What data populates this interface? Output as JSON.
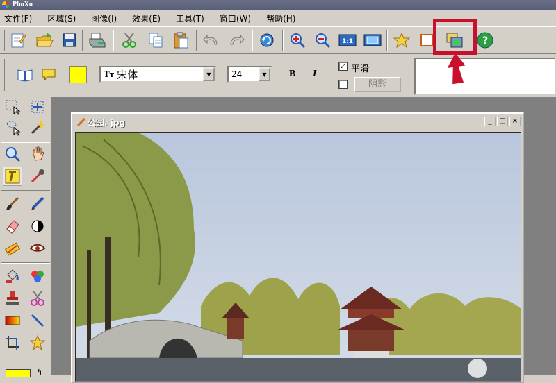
{
  "app": {
    "title": "PhoXo"
  },
  "menu": [
    "文件(F)",
    "区域(S)",
    "图像(I)",
    "效果(E)",
    "工具(T)",
    "窗口(W)",
    "帮助(H)"
  ],
  "toolbar": {
    "buttons": [
      "new",
      "open",
      "save",
      "print",
      "cut",
      "copy",
      "paste",
      "undo",
      "redo",
      "refresh",
      "zoom-in",
      "zoom-out",
      "actual-size",
      "fit-window",
      "favorite",
      "frame",
      "layer-image",
      "help"
    ],
    "help_glyph": "?",
    "actual_size_label": "1:1"
  },
  "text_toolbar": {
    "color": "#ffff00",
    "font_icon": "Tт",
    "font_value": "宋体",
    "size_value": "24",
    "bold_label": "B",
    "italic_label": "I",
    "smooth_label": "平滑",
    "smooth_checked": true,
    "shadow_checked": false,
    "shadow_label": "阴影",
    "text_value": ""
  },
  "document": {
    "title": "公园. jpg",
    "minimize": "_",
    "maximize": "□",
    "close": "×"
  },
  "annotation": {
    "color": "#c8102e"
  },
  "tools": [
    "rect-select",
    "move",
    "lasso-select",
    "magic-wand",
    "zoom",
    "hand",
    "text",
    "eyedropper",
    "brush",
    "pen",
    "eraser",
    "contrast",
    "clone",
    "red-eye",
    "fill",
    "color-replace",
    "stamp",
    "scissors",
    "gradient",
    "line",
    "crop",
    "star"
  ],
  "active_tool": "text",
  "foreground_color": "#ffff00"
}
